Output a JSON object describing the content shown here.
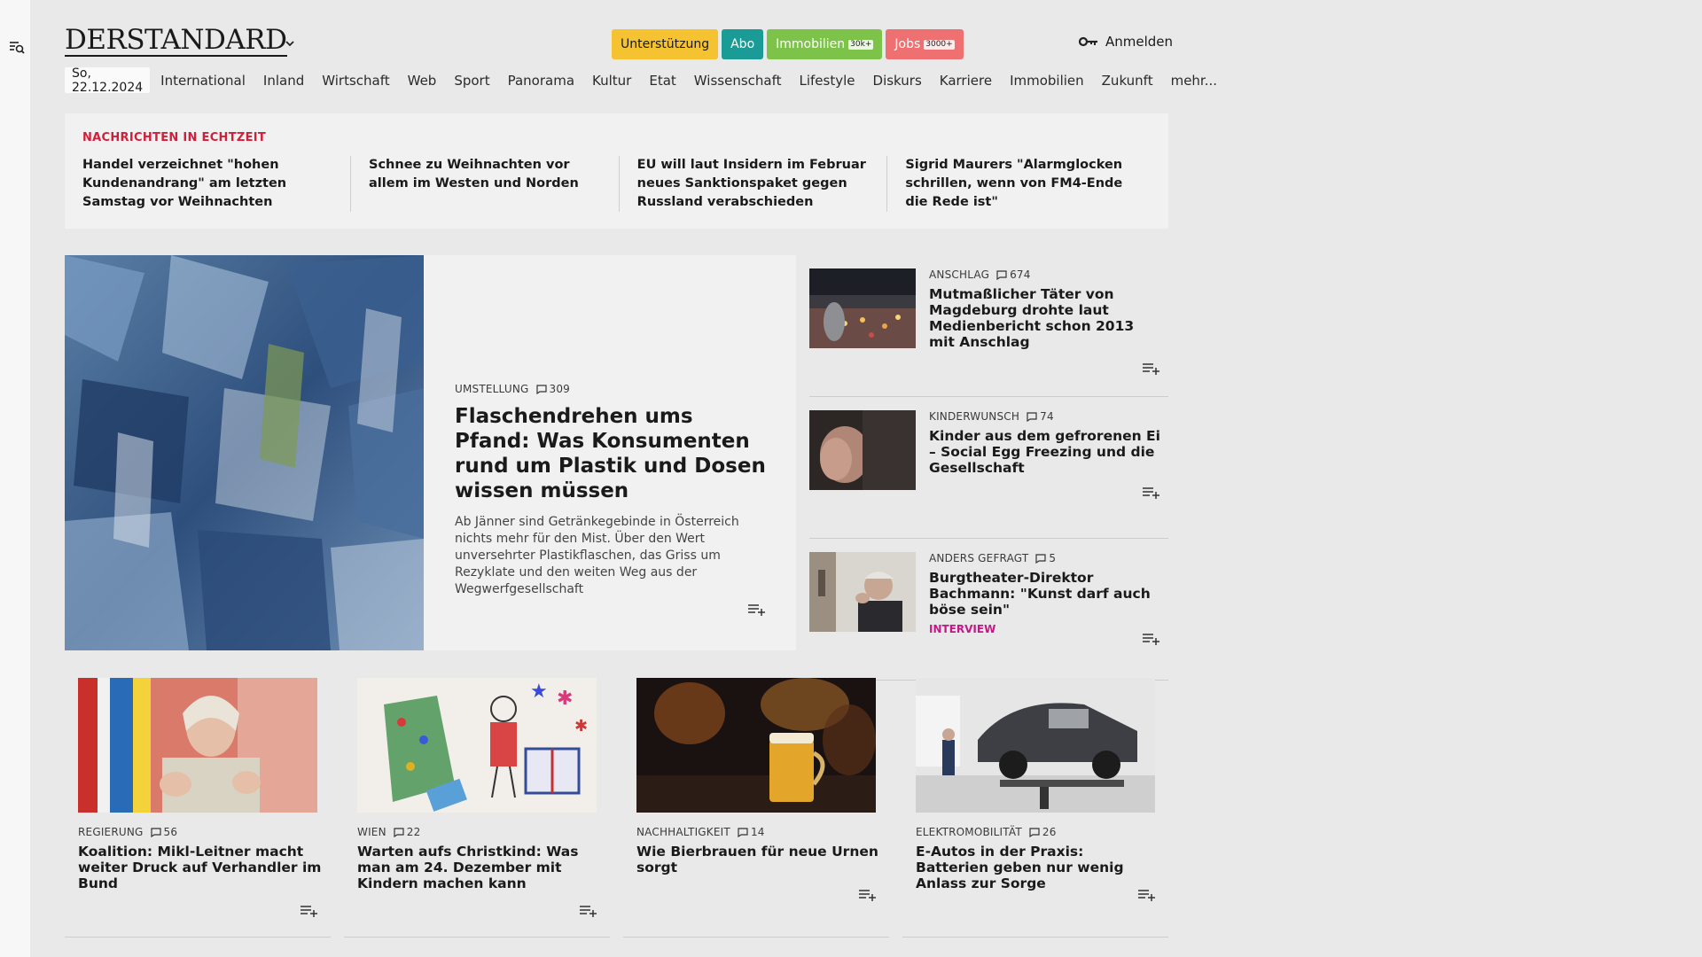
{
  "header": {
    "logo": "DERSTANDARD",
    "pills": [
      {
        "label": "Unterstützung",
        "badge": "",
        "bg": "#f5c232",
        "fg": "#1a1a1a"
      },
      {
        "label": "Abo",
        "badge": "",
        "bg": "#1a9b95",
        "fg": "#ffffff"
      },
      {
        "label": "Immobilien",
        "badge": "30k+",
        "bg": "#7dc34a",
        "fg": "#ffffff"
      },
      {
        "label": "Jobs",
        "badge": "3000+",
        "bg": "#ef7070",
        "fg": "#ffffff"
      }
    ],
    "login_label": "Anmelden"
  },
  "nav": {
    "date": "So, 22.12.2024",
    "items": [
      "International",
      "Inland",
      "Wirtschaft",
      "Web",
      "Sport",
      "Panorama",
      "Kultur",
      "Etat",
      "Wissenschaft",
      "Lifestyle",
      "Diskurs",
      "Karriere",
      "Immobilien",
      "Zukunft",
      "mehr..."
    ]
  },
  "ticker": {
    "title": "NACHRICHTEN IN ECHTZEIT",
    "items": [
      "Handel verzeichnet \"hohen Kunden­andrang\" am letzten Samstag vor Weihnachten",
      "Schnee zu Weihnachten vor allem im Westen und Norden",
      "EU will laut Insidern im Februar neues Sanktionspaket gegen Russland verabschieden",
      "Sigrid Maurers \"Alarmglocken schril­len, wenn von FM4-Ende die Rede ist\""
    ]
  },
  "lead": {
    "kicker": "UMSTELLUNG",
    "comments": "309",
    "title": "Flaschendrehen ums Pfand: Was Konsumenten rund um Plastik und Dosen wissen müssen",
    "teaser": "Ab Jänner sind Getränkegebinde in Österreich nichts mehr für den Mist. Über den Wert unversehrter Plastikflaschen, das Griss um Rezyklate und den weiten Weg aus der Wegwerfge­sellschaft"
  },
  "side": [
    {
      "kicker": "ANSCHLAG",
      "comments": "674",
      "title": "Mutmaßlicher Täter von Magdeburg drohte laut Medienbericht schon 2013 mit Anschlag",
      "tag": ""
    },
    {
      "kicker": "KINDERWUNSCH",
      "comments": "74",
      "title": "Kinder aus dem gefrorenen Ei – Social Egg Freezing und die Gesellschaft",
      "tag": ""
    },
    {
      "kicker": "ANDERS GEFRAGT",
      "comments": "5",
      "title": "Burgtheater-Direktor Bachmann: \"Kunst darf auch böse sein\"",
      "tag": "INTERVIEW"
    }
  ],
  "cards": [
    {
      "kicker": "REGIERUNG",
      "comments": "56",
      "title": "Koalition: Mikl-Leitner macht weiter Druck auf Verhandler im Bund"
    },
    {
      "kicker": "WIEN",
      "comments": "22",
      "title": "Warten aufs Christkind: Was man am 24. Dezember mit Kindern machen kann"
    },
    {
      "kicker": "NACHHALTIGKEIT",
      "comments": "14",
      "title": "Wie Bierbrauen für neue Urnen sorgt"
    },
    {
      "kicker": "ELEKTROMOBILITÄT",
      "comments": "26",
      "title": "E-Autos in der Praxis: Batterien geben nur wenig Anlass zur Sorge"
    }
  ]
}
